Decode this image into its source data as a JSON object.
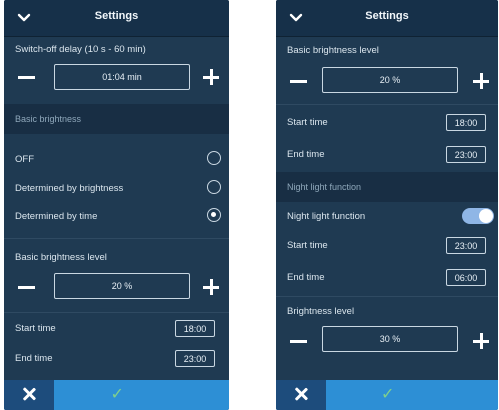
{
  "left_screen": {
    "title": "Settings",
    "switch_off_label": "Switch-off delay (10 s - 60 min)",
    "switch_off_value": "01:04 min",
    "basic_brightness_header": "Basic brightness",
    "options": [
      {
        "label": "OFF",
        "selected": false
      },
      {
        "label": "Determined by brightness",
        "selected": false
      },
      {
        "label": "Determined by time",
        "selected": true
      }
    ],
    "level_label": "Basic brightness level",
    "level_value": "20 %",
    "start_label": "Start time",
    "start_value": "18:00",
    "end_label": "End time",
    "end_value": "23:00"
  },
  "right_screen": {
    "title": "Settings",
    "level_label": "Basic brightness level",
    "level_value": "20 %",
    "start_label": "Start time",
    "start_value": "18:00",
    "end_label": "End time",
    "end_value": "23:00",
    "night_header": "Night light function",
    "night_toggle_label": "Night light function",
    "night_toggle_on": true,
    "night_start_label": "Start time",
    "night_start_value": "23:00",
    "night_end_label": "End time",
    "night_end_value": "06:00",
    "brightness_label": "Brightness level",
    "brightness_value": "30 %"
  },
  "colors": {
    "background": "#1f3a52",
    "accent": "#2d8fd5",
    "check": "#7fd08b"
  }
}
